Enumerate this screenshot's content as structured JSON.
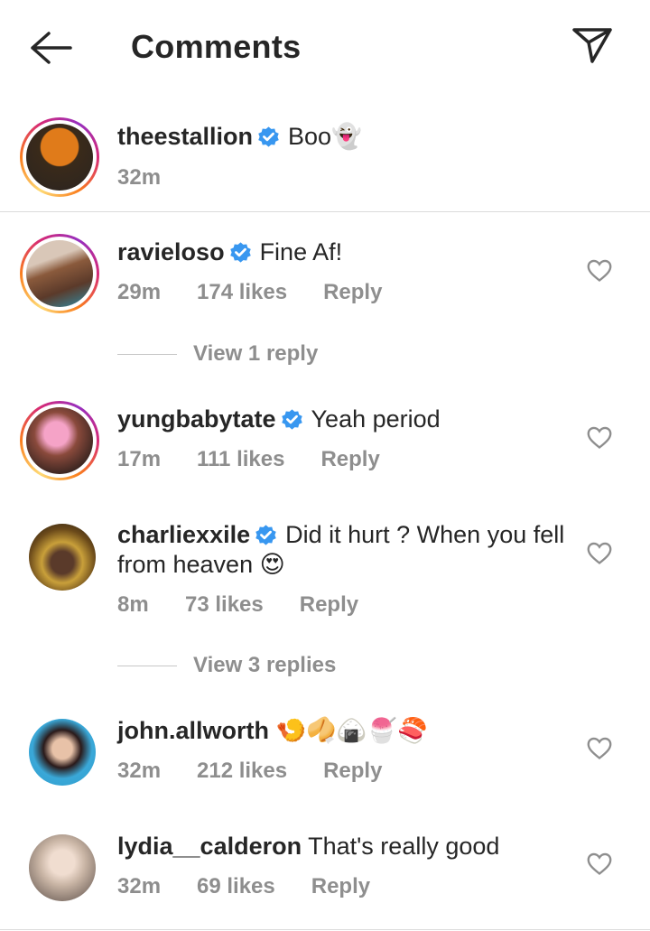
{
  "header": {
    "title": "Comments"
  },
  "caption": {
    "username": "theestallion",
    "text": "Boo👻",
    "time": "32m"
  },
  "comments": [
    {
      "username": "ravieloso",
      "verified": true,
      "text": "Fine Af!",
      "time": "29m",
      "likes": "174 likes",
      "reply": "Reply",
      "view_replies": "View 1 reply"
    },
    {
      "username": "yungbabytate",
      "verified": true,
      "text": "Yeah period",
      "time": "17m",
      "likes": "111 likes",
      "reply": "Reply"
    },
    {
      "username": "charliexxile",
      "verified": true,
      "text": "Did it hurt ? When you fell from heaven 😍",
      "time": "8m",
      "likes": "73 likes",
      "reply": "Reply",
      "view_replies": "View 3 replies"
    },
    {
      "username": "john.allworth",
      "verified": false,
      "text": "🍤🥠🍙🍧🍣",
      "time": "32m",
      "likes": "212 likes",
      "reply": "Reply"
    },
    {
      "username": "lydia__calderon",
      "verified": false,
      "text": "That's really good",
      "time": "32m",
      "likes": "69 likes",
      "reply": "Reply"
    }
  ],
  "colors": {
    "verified": "#3897f0",
    "secondary_text": "#8e8e8e",
    "divider": "#dbdbdb"
  },
  "icons": {
    "back": "arrow-left-icon",
    "send": "paper-plane-icon",
    "like": "heart-outline-icon",
    "verified": "verified-badge-icon"
  }
}
